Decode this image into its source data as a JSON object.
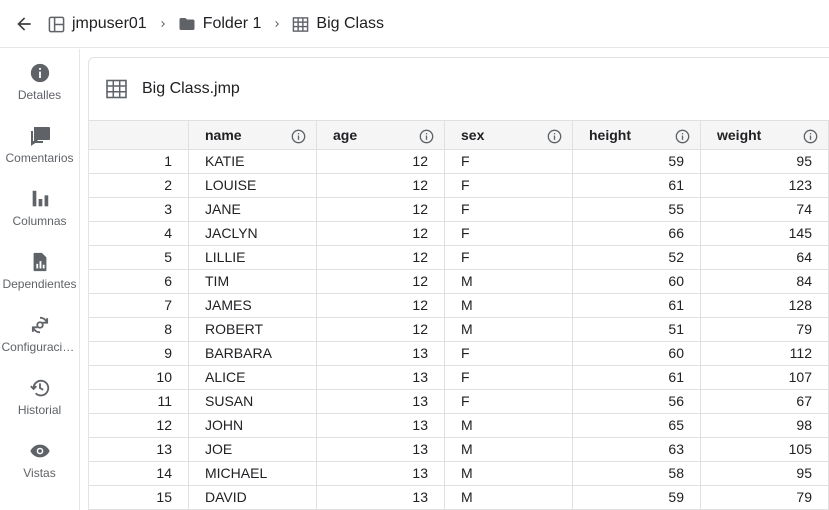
{
  "breadcrumb": {
    "items": [
      {
        "label": "jmpuser01",
        "icon": "workspace-icon"
      },
      {
        "label": "Folder 1",
        "icon": "folder-icon"
      },
      {
        "label": "Big Class",
        "icon": "table-icon"
      }
    ]
  },
  "sidenav": {
    "items": [
      {
        "label": "Detalles",
        "icon": "info-icon"
      },
      {
        "label": "Comentarios",
        "icon": "comment-icon"
      },
      {
        "label": "Columnas",
        "icon": "bar-chart-icon"
      },
      {
        "label": "Dependientes",
        "icon": "file-chart-icon"
      },
      {
        "label": "Configuraciones",
        "icon": "sync-settings-icon"
      },
      {
        "label": "Historial",
        "icon": "history-icon"
      },
      {
        "label": "Vistas",
        "icon": "eye-icon"
      }
    ]
  },
  "panel": {
    "title": "Big Class.jmp",
    "icon": "table-icon"
  },
  "table": {
    "columns": [
      "name",
      "age",
      "sex",
      "height",
      "weight"
    ],
    "rows": [
      {
        "n": "1",
        "name": "KATIE",
        "age": "12",
        "sex": "F",
        "height": "59",
        "weight": "95"
      },
      {
        "n": "2",
        "name": "LOUISE",
        "age": "12",
        "sex": "F",
        "height": "61",
        "weight": "123"
      },
      {
        "n": "3",
        "name": "JANE",
        "age": "12",
        "sex": "F",
        "height": "55",
        "weight": "74"
      },
      {
        "n": "4",
        "name": "JACLYN",
        "age": "12",
        "sex": "F",
        "height": "66",
        "weight": "145"
      },
      {
        "n": "5",
        "name": "LILLIE",
        "age": "12",
        "sex": "F",
        "height": "52",
        "weight": "64"
      },
      {
        "n": "6",
        "name": "TIM",
        "age": "12",
        "sex": "M",
        "height": "60",
        "weight": "84"
      },
      {
        "n": "7",
        "name": "JAMES",
        "age": "12",
        "sex": "M",
        "height": "61",
        "weight": "128"
      },
      {
        "n": "8",
        "name": "ROBERT",
        "age": "12",
        "sex": "M",
        "height": "51",
        "weight": "79"
      },
      {
        "n": "9",
        "name": "BARBARA",
        "age": "13",
        "sex": "F",
        "height": "60",
        "weight": "112"
      },
      {
        "n": "10",
        "name": "ALICE",
        "age": "13",
        "sex": "F",
        "height": "61",
        "weight": "107"
      },
      {
        "n": "11",
        "name": "SUSAN",
        "age": "13",
        "sex": "F",
        "height": "56",
        "weight": "67"
      },
      {
        "n": "12",
        "name": "JOHN",
        "age": "13",
        "sex": "M",
        "height": "65",
        "weight": "98"
      },
      {
        "n": "13",
        "name": "JOE",
        "age": "13",
        "sex": "M",
        "height": "63",
        "weight": "105"
      },
      {
        "n": "14",
        "name": "MICHAEL",
        "age": "13",
        "sex": "M",
        "height": "58",
        "weight": "95"
      },
      {
        "n": "15",
        "name": "DAVID",
        "age": "13",
        "sex": "M",
        "height": "59",
        "weight": "79"
      }
    ]
  }
}
